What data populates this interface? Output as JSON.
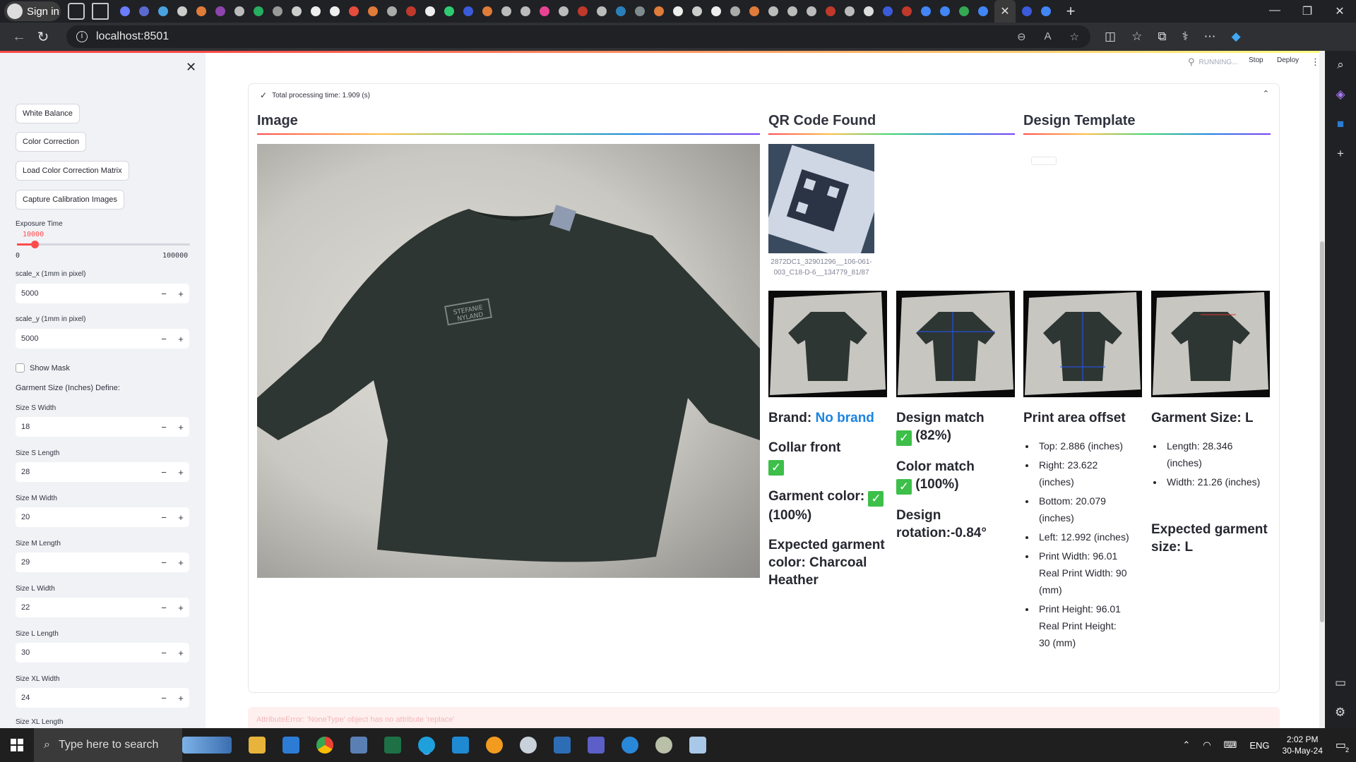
{
  "browser": {
    "signin_label": "Sign in",
    "url": "localhost:8501"
  },
  "app_header": {
    "running": "RUNNING...",
    "stop": "Stop",
    "deploy": "Deploy"
  },
  "sidebar": {
    "buttons": [
      "White Balance",
      "Color Correction",
      "Load Color Correction Matrix",
      "Capture Calibration Images"
    ],
    "exposure": {
      "label": "Exposure Time",
      "value": "10000",
      "min": "0",
      "max": "100000",
      "fraction": 0.1
    },
    "scale_x": {
      "label": "scale_x (1mm in pixel)",
      "value": "5000"
    },
    "scale_y": {
      "label": "scale_y (1mm in pixel)",
      "value": "5000"
    },
    "show_mask": "Show Mask",
    "size_define_title": "Garment Size (Inches) Define:",
    "sizes": [
      {
        "label": "Size S Width",
        "value": "18"
      },
      {
        "label": "Size S Length",
        "value": "28"
      },
      {
        "label": "Size M Width",
        "value": "20"
      },
      {
        "label": "Size M Length",
        "value": "29"
      },
      {
        "label": "Size L Width",
        "value": "22"
      },
      {
        "label": "Size L Length",
        "value": "30"
      },
      {
        "label": "Size XL Width",
        "value": "24"
      }
    ],
    "next_label": "Size XL Length"
  },
  "main": {
    "processing_time": "Total processing time: 1.909 (s)",
    "col_image": "Image",
    "col_qr": "QR Code Found",
    "col_template": "Design Template",
    "qr_caption": "2872DC1_32901296__106-061-003_C18-D-6__134779_81/87",
    "brand_prefix": "Brand:",
    "brand_value": "No brand",
    "collar": "Collar front",
    "garment_color": "Garment color:",
    "garment_color_pct": "(100%)",
    "expected_color": "Expected garment color: Charcoal Heather",
    "design_match": "Design match",
    "design_match_pct": "(82%)",
    "color_match": "Color match",
    "color_match_pct": "(100%)",
    "design_rotation": "Design rotation:-0.84°",
    "print_offset_title": "Print area offset",
    "offsets": [
      "Top: 2.886 (inches)",
      "Right: 23.622 (inches)",
      "Bottom: 20.079 (inches)",
      "Left: 12.992 (inches)",
      "Print Width: 96.01 Real Print Width: 90 (mm)",
      "Print Height: 96.01 Real Print Height: 30 (mm)"
    ],
    "garment_size_title": "Garment Size: L",
    "garment_dims": [
      "Length: 28.346 (inches)",
      "Width: 21.26 (inches)"
    ],
    "expected_size": "Expected garment size: L",
    "shirt_print_lines": [
      "STEFANIE",
      "NYLAND"
    ]
  },
  "error_text": "AttributeError: 'NoneType' object has no attribute 'replace'",
  "taskbar": {
    "search_placeholder": "Type here to search",
    "lang": "ENG",
    "time": "2:02 PM",
    "date": "30-May-24",
    "notif_count": "2"
  }
}
